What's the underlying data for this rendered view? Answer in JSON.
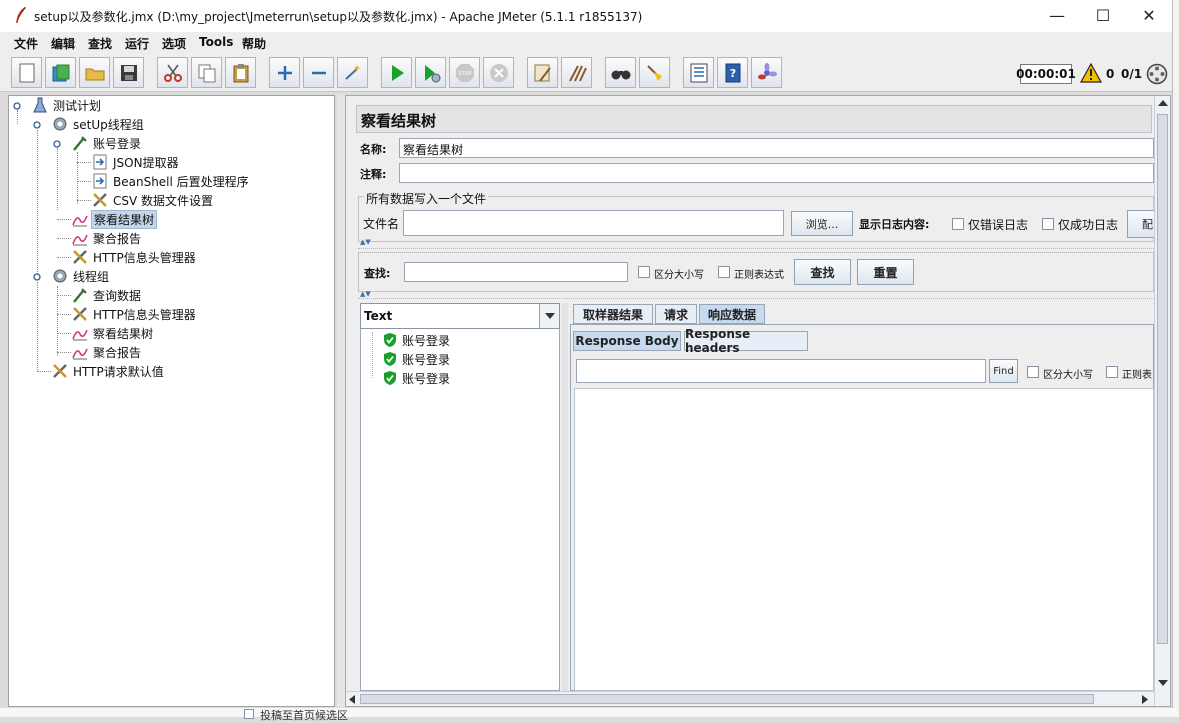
{
  "window": {
    "title": "setup以及参数化.jmx (D:\\my_project\\Jmeterrun\\setup以及参数化.jmx) - Apache JMeter (5.1.1 r1855137)",
    "minimize_glyph": "—",
    "maximize_glyph": "☐",
    "close_glyph": "✕"
  },
  "menu": [
    "文件",
    "编辑",
    "查找",
    "运行",
    "选项",
    "Tools",
    "帮助"
  ],
  "toolbar": {
    "timer": "00:00:01",
    "warnings": "0",
    "threads": "0/1"
  },
  "tree": [
    {
      "label": "测试计划",
      "icon": "flask-icon",
      "depth": 0
    },
    {
      "label": "setUp线程组",
      "icon": "gear-icon",
      "depth": 1
    },
    {
      "label": "账号登录",
      "icon": "pipette-icon",
      "depth": 2
    },
    {
      "label": "JSON提取器",
      "icon": "extractor-icon",
      "depth": 3
    },
    {
      "label": "BeanShell 后置处理程序",
      "icon": "extractor-icon",
      "depth": 3
    },
    {
      "label": "CSV 数据文件设置",
      "icon": "tools-icon",
      "depth": 3
    },
    {
      "label": "察看结果树",
      "icon": "graph-icon",
      "depth": 2,
      "selected": true
    },
    {
      "label": "聚合报告",
      "icon": "graph-icon",
      "depth": 2
    },
    {
      "label": "HTTP信息头管理器",
      "icon": "tools-icon",
      "depth": 2
    },
    {
      "label": "线程组",
      "icon": "gear-icon",
      "depth": 1
    },
    {
      "label": "查询数据",
      "icon": "pipette-icon",
      "depth": 2
    },
    {
      "label": "HTTP信息头管理器",
      "icon": "tools-icon",
      "depth": 2
    },
    {
      "label": "察看结果树",
      "icon": "graph-icon",
      "depth": 2
    },
    {
      "label": "聚合报告",
      "icon": "graph-icon",
      "depth": 2
    },
    {
      "label": "HTTP请求默认值",
      "icon": "tools-icon",
      "depth": 1
    }
  ],
  "panel": {
    "heading": "察看结果树",
    "name_label": "名称:",
    "name_value": "察看结果树",
    "comment_label": "注释:",
    "comment_value": "",
    "file_group_title": "所有数据写入一个文件",
    "filename_label": "文件名",
    "filename_value": "",
    "browse_label": "浏览...",
    "log_content_label": "显示日志内容:",
    "errors_only_label": "仅错误日志",
    "success_only_label": "仅成功日志",
    "config_label": "配",
    "search_label": "查找:",
    "search_value": "",
    "case_sensitive_label": "区分大小写",
    "regex_label": "正则表达式",
    "find_button": "查找",
    "reset_button": "重置"
  },
  "results": {
    "renderer": "Text",
    "items": [
      "账号登录",
      "账号登录",
      "账号登录"
    ]
  },
  "tabs": [
    "取样器结果",
    "请求",
    "响应数据"
  ],
  "active_tab": "响应数据",
  "subtabs": [
    "Response Body",
    "Response headers"
  ],
  "active_subtab": "Response Body",
  "response": {
    "find_value": "",
    "find_label": "Find",
    "case_label": "区分大小写",
    "regex_label": "正则表"
  },
  "background_snippet": "投稿至首页候选区",
  "colors": {
    "green": "#17a02a",
    "selection": "#c4d5ec",
    "warning": "#f2c200"
  }
}
